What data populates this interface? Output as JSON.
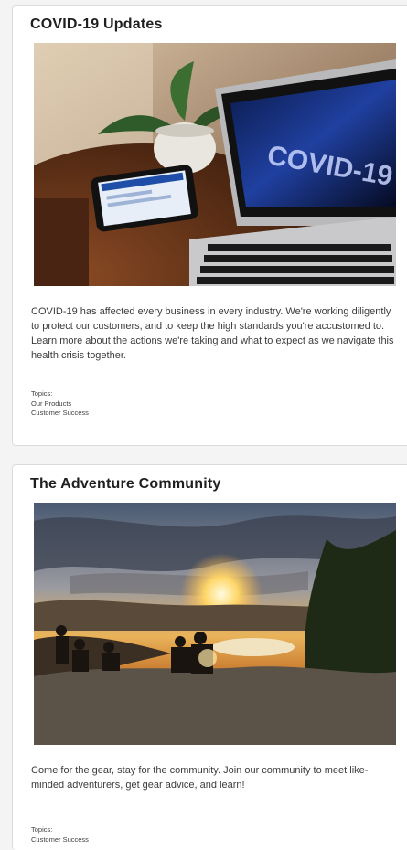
{
  "cards": [
    {
      "title": "COVID-19 Updates",
      "image_overlay_text": "COVID-19",
      "description": "COVID-19 has affected every business in every industry. We're working diligently to protect our customers, and to keep the high standards you're accustomed to. Learn more about the actions we're taking and what to expect as we navigate this health crisis together.",
      "topics_label": "Topics:",
      "topics": [
        "Our Products",
        "Customer Success"
      ]
    },
    {
      "title": "The Adventure Community",
      "description": "Come for the gear, stay for the community. Join our community to meet like-minded adventurers, get gear advice, and learn!",
      "topics_label": "Topics:",
      "topics": [
        "Customer Success"
      ]
    }
  ]
}
